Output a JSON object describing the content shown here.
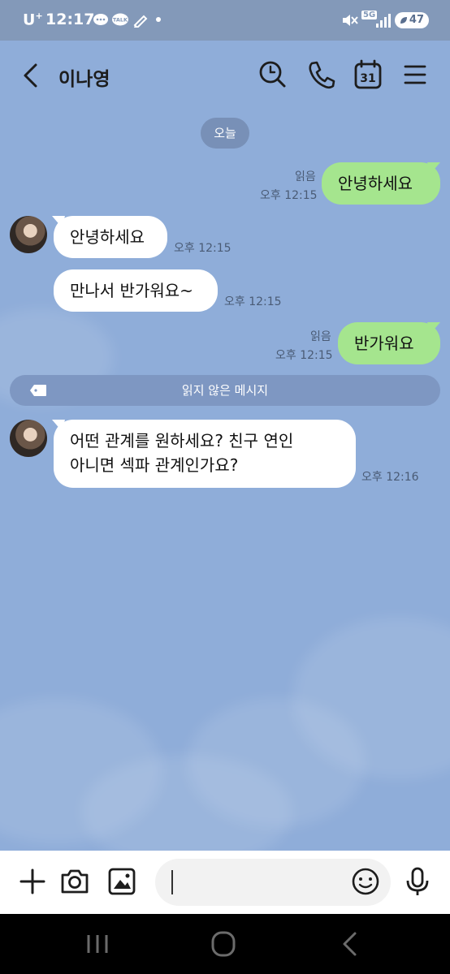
{
  "status_bar": {
    "carrier": "U",
    "carrier_sup": "+",
    "time": "12:17",
    "talk_badge": "TALK",
    "network": "5G",
    "battery": "47"
  },
  "header": {
    "title": "이나영",
    "calendar_day": "31"
  },
  "date_divider": "오늘",
  "messages": [
    {
      "sender": "me",
      "text": "안녕하세요",
      "read": "읽음",
      "time": "오후 12:15"
    },
    {
      "sender": "them",
      "text": "안녕하세요",
      "time": "오후 12:15"
    },
    {
      "sender": "them",
      "text": "만나서 반가워요~",
      "time": "오후 12:15"
    },
    {
      "sender": "me",
      "text": "반가워요",
      "read": "읽음",
      "time": "오후 12:15"
    },
    {
      "sender": "them",
      "text_line1": "어떤 관계를 원하세요? 친구 연인",
      "text_line2": "아니면 섹파 관계인가요?",
      "time": "오후 12:16"
    }
  ],
  "unread_divider": "읽지 않은 메시지",
  "input": {
    "placeholder": "",
    "value": ""
  },
  "colors": {
    "chat_background": "#8fadd9",
    "my_bubble": "#a5e58e",
    "their_bubble": "#ffffff",
    "status_bar": "#8399b9"
  },
  "icons": {
    "header": [
      "back-icon",
      "search-icon",
      "phone-icon",
      "calendar-icon",
      "menu-icon"
    ],
    "input_bar": [
      "plus-icon",
      "camera-icon",
      "gallery-icon",
      "emoji-icon",
      "mic-icon"
    ],
    "nav_bar": [
      "recent-apps-icon",
      "home-icon",
      "back-nav-icon"
    ]
  }
}
